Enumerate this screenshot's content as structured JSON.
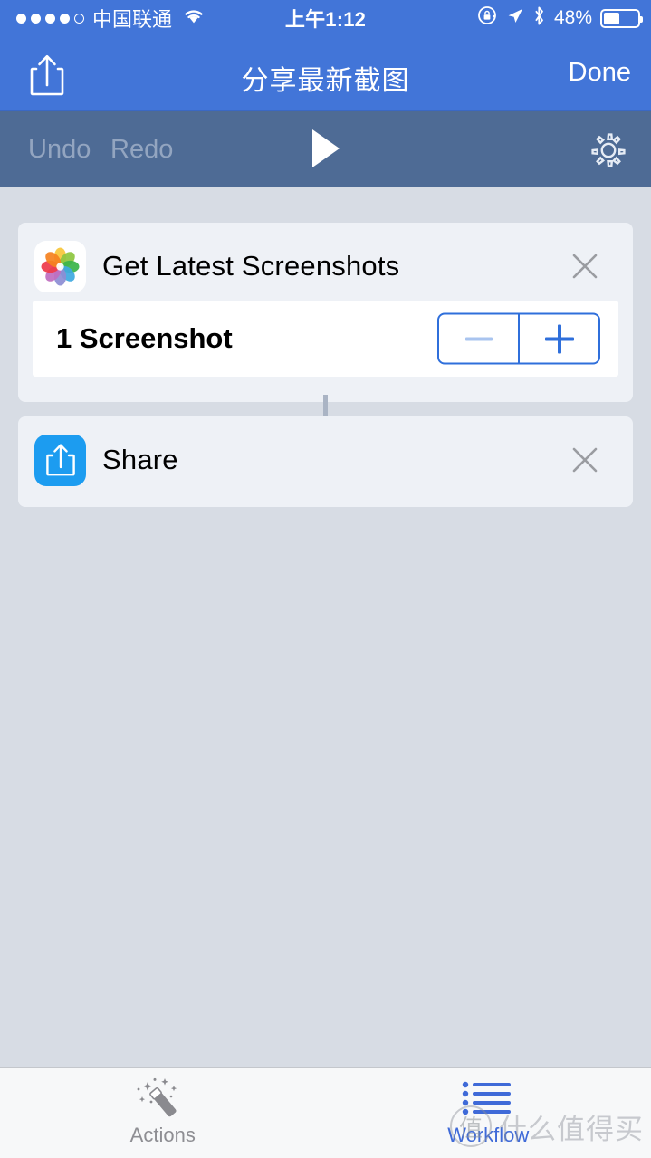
{
  "status_bar": {
    "signal_dots_filled": 4,
    "signal_dots_total": 5,
    "carrier": "中国联通",
    "wifi_icon": "wifi-icon",
    "time": "上午1:12",
    "rotation_lock_icon": "rotation-lock-icon",
    "location_icon": "location-arrow-icon",
    "bluetooth_icon": "bluetooth-icon",
    "battery_percent": "48%",
    "battery_fill_pct": 48
  },
  "nav_bar": {
    "share_icon": "share-icon",
    "title": "分享最新截图",
    "done_label": "Done",
    "background_color": "#4275d8"
  },
  "toolbar": {
    "undo_label": "Undo",
    "redo_label": "Redo",
    "run_icon": "play-icon",
    "settings_icon": "gear-icon",
    "background_color": "#4e6b95",
    "disabled_color": "#93a5c0"
  },
  "workflow": {
    "actions": [
      {
        "icon": "photos-app-icon",
        "title": "Get Latest Screenshots",
        "close_icon": "close-icon",
        "parameter": {
          "label": "1 Screenshot",
          "stepper": {
            "minus_label": "−",
            "plus_label": "+",
            "minus_enabled": false,
            "plus_enabled": true,
            "border_color": "#2f6fdb"
          }
        }
      },
      {
        "icon": "share-app-icon",
        "title": "Share",
        "close_icon": "close-icon",
        "icon_color": "#1c9cf0"
      }
    ]
  },
  "tab_bar": {
    "tabs": [
      {
        "label": "Actions",
        "icon": "magic-wand-icon",
        "active": false
      },
      {
        "label": "Workflow",
        "icon": "list-icon",
        "active": true
      }
    ],
    "active_color": "#3f6ad8",
    "inactive_color": "#8e8e93"
  },
  "watermark": {
    "badge": "值",
    "text": "什么值得买"
  }
}
